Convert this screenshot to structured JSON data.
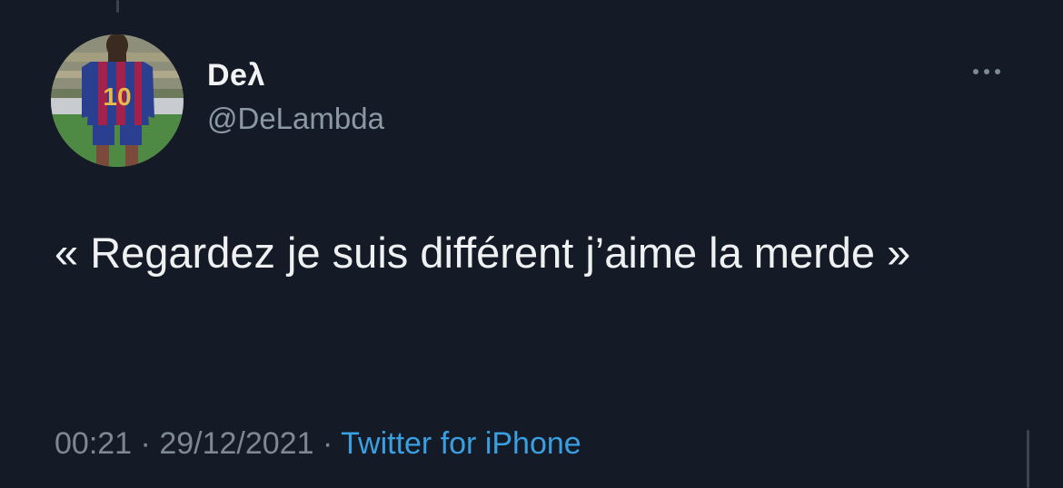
{
  "tweet": {
    "display_name": "Deλ",
    "handle": "@DeLambda",
    "text": "« Regardez je suis différent j’aime la merde »",
    "time": "00:21",
    "date": "29/12/2021",
    "separator": "·",
    "source": "Twitter for iPhone"
  },
  "avatar": {
    "jersey_number": "10"
  },
  "more_icon": "ellipsis-horizontal-icon",
  "colors": {
    "background": "#151b26",
    "primary_text": "#eef0f1",
    "secondary_text": "#8b98a5",
    "link": "#3a9fe0"
  }
}
